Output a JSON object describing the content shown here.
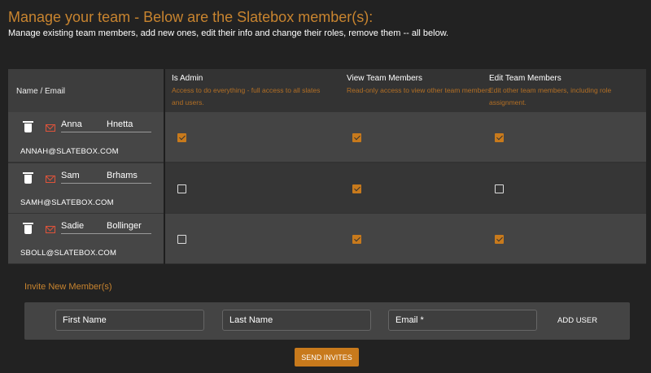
{
  "header": {
    "title": "Manage your team - Below are the Slatebox member(s):",
    "subtitle": "Manage existing team members, add new ones, edit their info and change their roles, remove them -- all below."
  },
  "table": {
    "name_header": "Name / Email",
    "columns": [
      {
        "label": "Is Admin",
        "desc": "Access to do everything - full access to all slates and users."
      },
      {
        "label": "View Team Members",
        "desc": "Read-only access to view other team members"
      },
      {
        "label": "Edit Team Members",
        "desc": "Edit other team members, including role assignment."
      }
    ],
    "members": [
      {
        "first": "Anna",
        "last": "Hnetta",
        "email": "ANNAH@SLATEBOX.COM",
        "roles": [
          true,
          true,
          true
        ]
      },
      {
        "first": "Sam",
        "last": "Brhams",
        "email": "SAMH@SLATEBOX.COM",
        "roles": [
          false,
          true,
          false
        ]
      },
      {
        "first": "Sadie",
        "last": "Bollinger",
        "email": "SBOLL@SLATEBOX.COM",
        "roles": [
          false,
          true,
          true
        ]
      }
    ]
  },
  "invite": {
    "title": "Invite New Member(s)",
    "first_placeholder": "First Name",
    "last_placeholder": "Last Name",
    "email_placeholder": "Email *",
    "add_label": "ADD USER",
    "send_label": "SEND INVITES"
  },
  "colors": {
    "accent": "#c87a1c",
    "background": "#222222",
    "mail_icon": "#e0533a"
  }
}
